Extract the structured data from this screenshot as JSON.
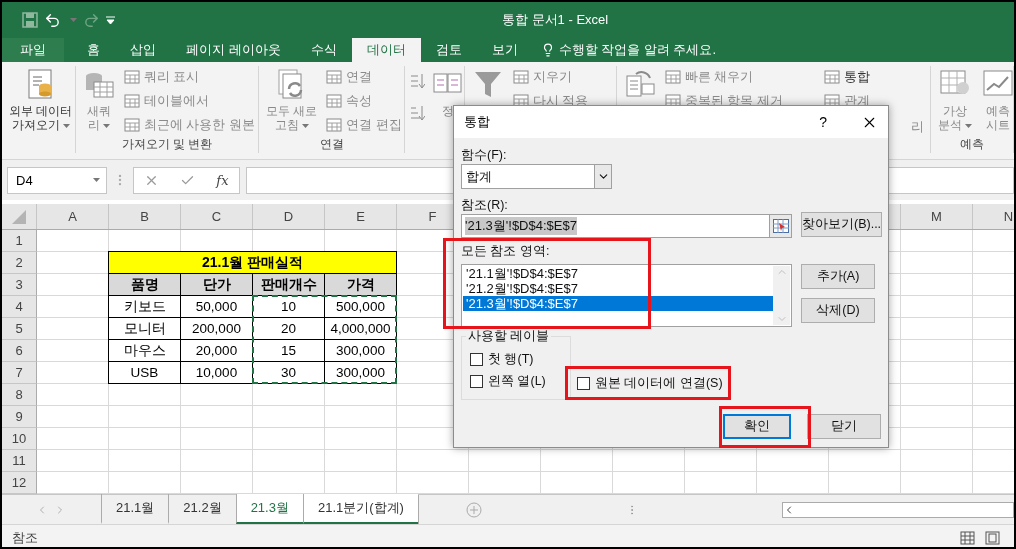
{
  "title_bar": {
    "title": "통합 문서1 - Excel"
  },
  "ribbon_tabs": [
    {
      "label": "파일",
      "selected": false,
      "kind": "file"
    },
    {
      "label": "홈",
      "selected": false,
      "kind": "tab"
    },
    {
      "label": "삽입",
      "selected": false,
      "kind": "tab"
    },
    {
      "label": "페이지 레이아웃",
      "selected": false,
      "kind": "tab"
    },
    {
      "label": "수식",
      "selected": false,
      "kind": "tab"
    },
    {
      "label": "데이터",
      "selected": true,
      "kind": "tab"
    },
    {
      "label": "검토",
      "selected": false,
      "kind": "tab"
    },
    {
      "label": "보기",
      "selected": false,
      "kind": "tab"
    }
  ],
  "tell_me": "수행할 작업을 알려 주세요.",
  "ribbon_groups": [
    {
      "items": [
        {
          "kind": "large",
          "label": "외부 데이터\n가져오기",
          "dropdown": true,
          "disabled": false
        }
      ]
    },
    {
      "label": "가져오기 및 변환",
      "items": [
        {
          "kind": "large",
          "label": "새쿼\n리",
          "dropdown": true,
          "disabled": true
        },
        {
          "kind": "small",
          "label": "쿼리 표시",
          "disabled": true
        },
        {
          "kind": "small",
          "label": "테이블에서",
          "disabled": true
        },
        {
          "kind": "small",
          "label": "최근에 사용한 원본",
          "disabled": true
        }
      ]
    },
    {
      "label": "연결",
      "items": [
        {
          "kind": "large",
          "label": "모두 새로\n고침",
          "dropdown": true,
          "disabled": true
        },
        {
          "kind": "small",
          "label": "연결",
          "disabled": true
        },
        {
          "kind": "small",
          "label": "속성",
          "disabled": true
        },
        {
          "kind": "small",
          "label": "연결 편집",
          "disabled": true
        }
      ]
    },
    {
      "items": [
        {
          "kind": "sort_icons"
        },
        {
          "kind": "large",
          "label": "정",
          "disabled": true
        }
      ]
    },
    {
      "items": [
        {
          "kind": "large"
        },
        {
          "kind": "small",
          "label": "지우기",
          "disabled": true
        },
        {
          "kind": "small",
          "label": "다시 적용",
          "disabled": true
        }
      ]
    },
    {
      "items": [
        {
          "kind": "large"
        },
        {
          "kind": "small",
          "label": "빠른 채우기",
          "disabled": true
        },
        {
          "kind": "small",
          "label": "중복된 항목 제거",
          "disabled": true
        },
        {
          "kind": "spacer"
        },
        {
          "kind": "small",
          "label": "통합",
          "disabled": false
        },
        {
          "kind": "small",
          "label": "관계",
          "disabled": true
        },
        {
          "kind": "fragment",
          "label": "리",
          "disabled": true
        }
      ]
    },
    {
      "label": "예측",
      "items": [
        {
          "kind": "large",
          "label": "가상\n분석",
          "dropdown": true,
          "disabled": true
        },
        {
          "kind": "large",
          "label": "예측\n시트",
          "disabled": true
        }
      ]
    }
  ],
  "formula_bar": {
    "name_box": "D4",
    "function_label": "fx"
  },
  "columns_left": [
    "A",
    "B",
    "C",
    "D",
    "E",
    "F"
  ],
  "columns_right": [
    "M",
    "N"
  ],
  "row_numbers": [
    "1",
    "2",
    "3",
    "4",
    "5",
    "6",
    "7",
    "8",
    "9",
    "10",
    "11",
    "12"
  ],
  "table": {
    "title": "21.1월 판매실적",
    "headers": [
      "품명",
      "단가",
      "판매개수",
      "가격"
    ],
    "rows": [
      [
        "키보드",
        "50,000",
        "10",
        "500,000"
      ],
      [
        "모니터",
        "200,000",
        "20",
        "4,000,000"
      ],
      [
        "마우스",
        "20,000",
        "15",
        "300,000"
      ],
      [
        "USB",
        "10,000",
        "30",
        "300,000"
      ]
    ]
  },
  "sheet_tabs": [
    {
      "label": "21.1월",
      "selected": false,
      "active": false
    },
    {
      "label": "21.2월",
      "selected": false,
      "active": false
    },
    {
      "label": "21.3월",
      "selected": true,
      "active": true
    },
    {
      "label": "21.1분기(합계)",
      "selected": true,
      "active": false
    }
  ],
  "status_bar": {
    "mode": "참조"
  },
  "dialog": {
    "title": "통합",
    "help": "?",
    "function_label": "함수(F):",
    "function_value": "합계",
    "reference_label": "참조(R):",
    "reference_value": "'21.3월'!$D$4:$E$7",
    "browse_button": "찾아보기(B)...",
    "all_references_label": "모든 참조 영역:",
    "references": [
      {
        "text": "'21.1월'!$D$4:$E$7",
        "selected": false
      },
      {
        "text": "'21.2월'!$D$4:$E$7",
        "selected": false
      },
      {
        "text": "'21.3월'!$D$4:$E$7",
        "selected": true
      }
    ],
    "add_button": "추가(A)",
    "delete_button": "삭제(D)",
    "labels_group": "사용할 레이블",
    "checkboxes": [
      {
        "label": "첫 행(T)",
        "checked": false
      },
      {
        "label": "왼쪽 열(L)",
        "checked": false
      },
      {
        "label": "원본 데이터에 연결(S)",
        "checked": false
      }
    ],
    "ok_button": "확인",
    "close_button": "닫기"
  }
}
